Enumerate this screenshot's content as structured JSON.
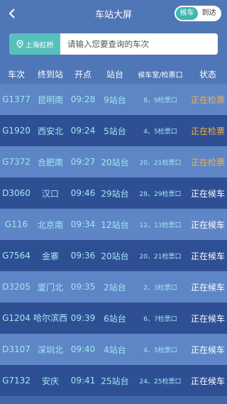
{
  "header": {
    "title": "车站大屏",
    "toggle": [
      {
        "label": "候车",
        "active": true
      },
      {
        "label": "到达",
        "active": false
      }
    ]
  },
  "search": {
    "station": "上海虹桥",
    "placeholder": "请输入您要查询的车次"
  },
  "columns": [
    "车次",
    "终到站",
    "开点",
    "站台",
    "候车室/检票口",
    "状态"
  ],
  "colors": {
    "accent": "#57c0bc",
    "status_checking": "#f0b040",
    "cell_text": "#9ee8f0"
  },
  "rows": [
    {
      "train": "G1377",
      "dest": "昆明南",
      "time": "09:28",
      "platform": "9站台",
      "gate": "8、9检票口",
      "status": "正在检票"
    },
    {
      "train": "G1920",
      "dest": "西安北",
      "time": "09:24",
      "platform": "5站台",
      "gate": "4、5检票口",
      "status": "正在检票"
    },
    {
      "train": "G7372",
      "dest": "合肥南",
      "time": "09:27",
      "platform": "20站台",
      "gate": "20、21检票口",
      "status": "正在检票"
    },
    {
      "train": "D3060",
      "dest": "汉口",
      "time": "09:46",
      "platform": "29站台",
      "gate": "28、29检票口",
      "status": "正在候车"
    },
    {
      "train": "G116",
      "dest": "北京南",
      "time": "09:34",
      "platform": "12站台",
      "gate": "12、13检票口",
      "status": "正在候车"
    },
    {
      "train": "G7564",
      "dest": "金寨",
      "time": "09:36",
      "platform": "20站台",
      "gate": "20、21检票口",
      "status": "正在候车"
    },
    {
      "train": "D3205",
      "dest": "厦门北",
      "time": "09:35",
      "platform": "2站台",
      "gate": "2、3检票口",
      "status": "正在候车"
    },
    {
      "train": "G1204",
      "dest": "哈尔滨西",
      "time": "09:39",
      "platform": "6站台",
      "gate": "6、7检票口",
      "status": "正在候车"
    },
    {
      "train": "D3107",
      "dest": "深圳北",
      "time": "09:40",
      "platform": "4站台",
      "gate": "4、5检票口",
      "status": "正在候车"
    },
    {
      "train": "G7132",
      "dest": "安庆",
      "time": "09:41",
      "platform": "25站台",
      "gate": "24、25检票口",
      "status": "正在候车"
    }
  ]
}
